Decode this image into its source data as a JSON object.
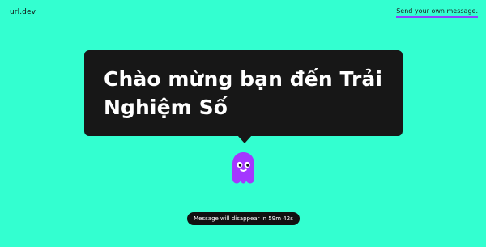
{
  "header": {
    "logo_text": "url.dev",
    "send_link_label": "Send your own message."
  },
  "message": {
    "text": "Chào mừng bạn đến Trải Nghiệm Số"
  },
  "mascot": {
    "icon": "ghost-icon",
    "color": "#a437ff"
  },
  "status": {
    "countdown_text": "Message will disappear in 59m 42s"
  },
  "colors": {
    "background": "#33ffd0",
    "bubble": "#171717",
    "accent_underline": "#8b43ff",
    "toast": "#111111"
  }
}
